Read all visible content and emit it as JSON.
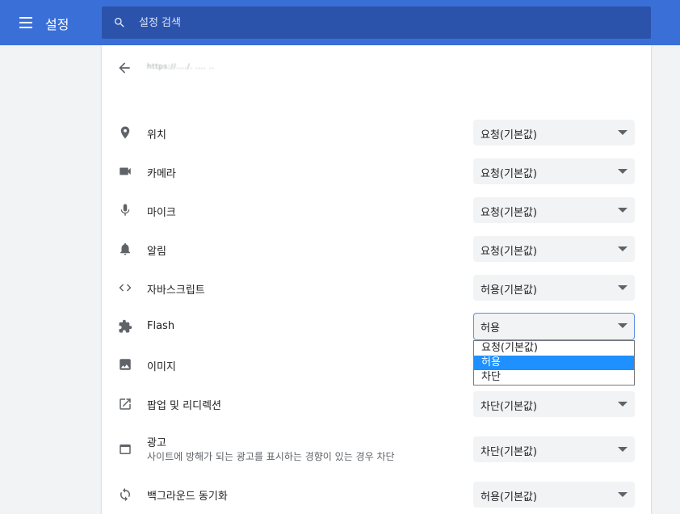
{
  "header": {
    "title": "설정",
    "search_placeholder": "설정 검색"
  },
  "site": {
    "url": "https://..../. ....  .."
  },
  "permissions": [
    {
      "label": "위치",
      "value": "요청(기본값)",
      "icon": "location-pin-icon"
    },
    {
      "label": "카메라",
      "value": "요청(기본값)",
      "icon": "camera-icon"
    },
    {
      "label": "마이크",
      "value": "요청(기본값)",
      "icon": "microphone-icon"
    },
    {
      "label": "알림",
      "value": "요청(기본값)",
      "icon": "bell-icon"
    },
    {
      "label": "자바스크립트",
      "value": "허용(기본값)",
      "icon": "code-icon"
    },
    {
      "label": "Flash",
      "value": "허용",
      "icon": "puzzle-icon"
    },
    {
      "label": "이미지",
      "value": "",
      "icon": "image-icon"
    },
    {
      "label": "팝업 및 리디렉션",
      "value": "차단(기본값)",
      "icon": "open-in-new-icon"
    },
    {
      "label": "광고",
      "sub": "사이트에 방해가 되는 광고를 표시하는 경향이 있는 경우 차단",
      "value": "차단(기본값)",
      "icon": "web-asset-icon"
    },
    {
      "label": "백그라운드 동기화",
      "value": "허용(기본값)",
      "icon": "sync-icon"
    }
  ],
  "dropdown": {
    "options": [
      "요청(기본값)",
      "허용",
      "차단"
    ],
    "selected_index": 1
  },
  "colors": {
    "header": "#3b6fd8",
    "search_bg": "#2b53ab",
    "highlight": "#1e90ff"
  }
}
